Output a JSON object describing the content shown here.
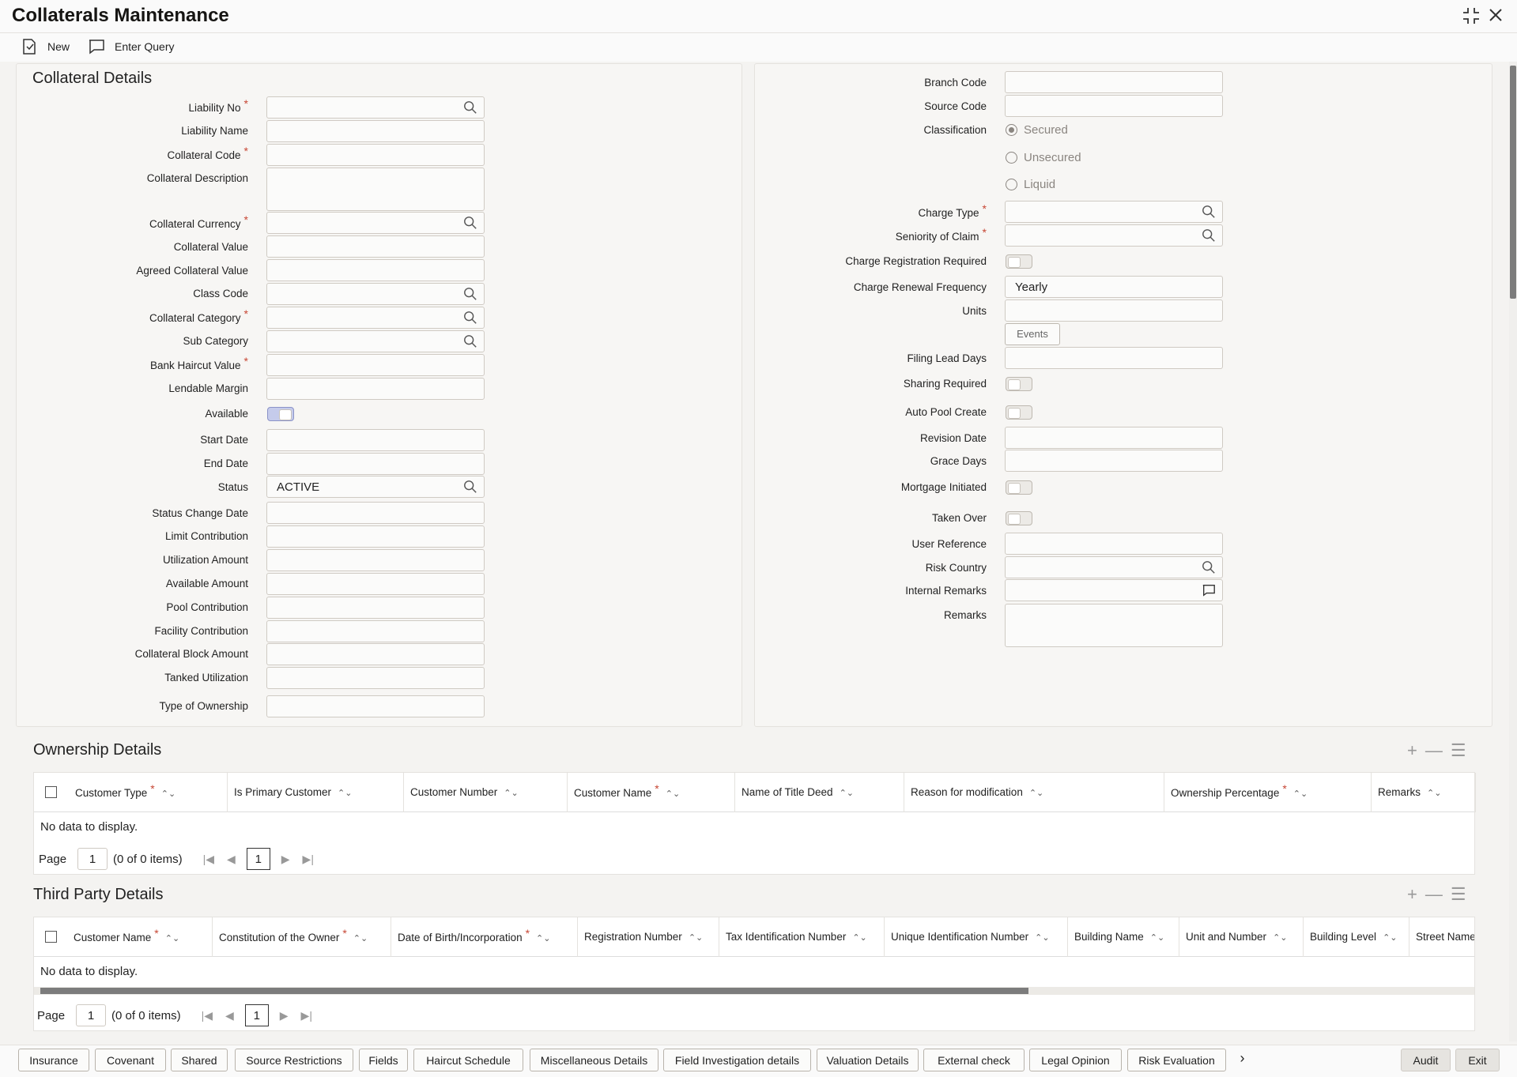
{
  "app": {
    "title": "Collaterals Maintenance"
  },
  "toolbar": {
    "new_label": "New",
    "enter_query_label": "Enter Query"
  },
  "collateral_details": {
    "title": "Collateral Details",
    "labels": {
      "liability_no": "Liability No",
      "liability_name": "Liability Name",
      "collateral_code": "Collateral Code",
      "collateral_description": "Collateral Description",
      "collateral_currency": "Collateral Currency",
      "collateral_value": "Collateral Value",
      "agreed_collateral_value": "Agreed Collateral Value",
      "class_code": "Class Code",
      "collateral_category": "Collateral Category",
      "sub_category": "Sub Category",
      "bank_haircut_value": "Bank Haircut Value",
      "lendable_margin": "Lendable Margin",
      "available": "Available",
      "start_date": "Start Date",
      "end_date": "End Date",
      "status": "Status",
      "status_change_date": "Status Change Date",
      "limit_contribution": "Limit Contribution",
      "utilization_amount": "Utilization Amount",
      "available_amount": "Available Amount",
      "pool_contribution": "Pool Contribution",
      "facility_contribution": "Facility Contribution",
      "collateral_block_amount": "Collateral Block Amount",
      "tanked_utilization": "Tanked Utilization",
      "type_of_ownership": "Type of Ownership"
    },
    "values": {
      "status": "ACTIVE"
    },
    "available_on": true
  },
  "right_panel": {
    "labels": {
      "branch_code": "Branch Code",
      "source_code": "Source Code",
      "classification": "Classification",
      "charge_type": "Charge Type",
      "seniority_of_claim": "Seniority of Claim",
      "charge_registration_required": "Charge Registration Required",
      "charge_renewal_frequency": "Charge Renewal Frequency",
      "units": "Units",
      "filing_lead_days": "Filing Lead Days",
      "sharing_required": "Sharing Required",
      "auto_pool_create": "Auto Pool Create",
      "revision_date": "Revision Date",
      "grace_days": "Grace Days",
      "mortgage_initiated": "Mortgage Initiated",
      "taken_over": "Taken Over",
      "user_reference": "User Reference",
      "risk_country": "Risk Country",
      "internal_remarks": "Internal Remarks",
      "remarks": "Remarks"
    },
    "classification_options": [
      "Secured",
      "Unsecured",
      "Liquid"
    ],
    "classification_selected": "Secured",
    "values": {
      "charge_renewal_frequency": "Yearly"
    },
    "events_label": "Events"
  },
  "ownership": {
    "title": "Ownership Details",
    "columns": [
      "Customer Type",
      "Is Primary Customer",
      "Customer Number",
      "Customer Name",
      "Name of Title Deed",
      "Reason for modification",
      "Ownership Percentage",
      "Remarks"
    ],
    "no_data": "No data to display.",
    "pager": {
      "page_label": "Page",
      "page": "1",
      "items": "(0 of 0 items)",
      "current": "1"
    }
  },
  "third_party": {
    "title": "Third Party Details",
    "columns": [
      "Customer Name",
      "Constitution of the Owner",
      "Date of Birth/Incorporation",
      "Registration Number",
      "Tax Identification Number",
      "Unique Identification Number",
      "Building Name",
      "Unit and Number",
      "Building Level",
      "Street Name"
    ],
    "no_data": "No data to display.",
    "pager": {
      "page_label": "Page",
      "page": "1",
      "items": "(0 of 0 items)",
      "current": "1"
    }
  },
  "footer": {
    "tabs": [
      "Insurance",
      "Covenant",
      "Shared",
      "Source Restrictions",
      "Fields",
      "Haircut Schedule",
      "Miscellaneous Details",
      "Field Investigation details",
      "Valuation Details",
      "External check",
      "Legal Opinion",
      "Risk Evaluation"
    ],
    "audit_label": "Audit",
    "exit_label": "Exit"
  },
  "colors": {
    "required": "#c74634",
    "toggle_on": "#c5cbeb"
  }
}
